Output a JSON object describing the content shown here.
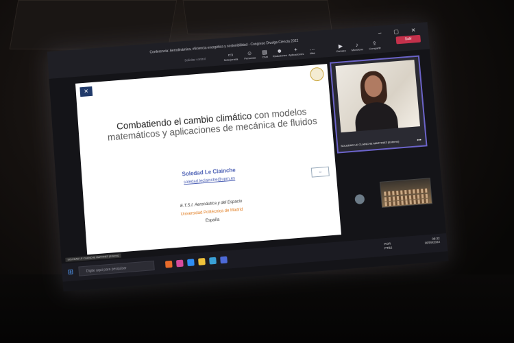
{
  "window": {
    "title": "Conferencia: Aerodinámica, eficiencia energética y sostenibilidad - Congreso Divulga Ciencia 2022",
    "request_control": "Solicitar control",
    "toolbar": [
      {
        "label": "Nota jurada",
        "icon": "note-icon"
      },
      {
        "label": "Personas",
        "icon": "people-icon"
      },
      {
        "label": "Chat",
        "icon": "chat-icon"
      },
      {
        "label": "Reacciones",
        "icon": "reactions-icon"
      },
      {
        "label": "Aplicaciones",
        "icon": "apps-icon"
      },
      {
        "label": "Más",
        "icon": "more-icon"
      },
      {
        "label": "Cámara",
        "icon": "camera-icon"
      },
      {
        "label": "Micrófono",
        "icon": "microphone-icon"
      },
      {
        "label": "Compartir",
        "icon": "share-icon"
      }
    ],
    "leave_label": "Salir"
  },
  "slide": {
    "title_dark": "Combatiendo el cambio climático",
    "title_light_1": "con",
    "title_light_2": "modelos matemáticos y aplicaciones de mecánica de fluidos",
    "author": "Soledad Le Clainche",
    "email": "soledad.leclainche@upm.es",
    "affiliation_1": "E.T.S.I. Aeronáutica y del Espacio",
    "affiliation_2": "Universidad Politécnica de Madrid",
    "affiliation_3": "España"
  },
  "participant": {
    "name": "SOLEDAD LE CLAINCHE MARTINEZ (Externo)"
  },
  "caption_label": "SOLEDAD LE CLAINCHE MARTINEZ (Externo)",
  "taskbar": {
    "search_placeholder": "Digite aquí para pesquisar",
    "lang_1": "POR",
    "lang_2": "PTB2",
    "time": "09:32",
    "date": "16/09/2022"
  }
}
